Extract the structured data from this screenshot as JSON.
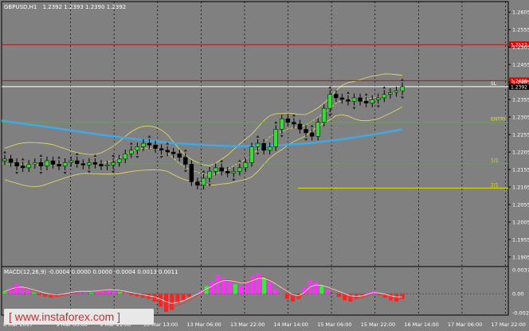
{
  "header": {
    "symbol": "GBPUSD,H1",
    "ohlc": "1.2392 1.2393 1.2390 1.2392"
  },
  "watermark": "[  www.instaforex.com ]",
  "macd_header": "MACD(12,26,9) -0.0004 0.0000 0.0000 -0.0004 0.0013 0.0011",
  "chart_data": {
    "type": "line",
    "symbol": "GBPUSD",
    "timeframe": "H1",
    "price_axis": {
      "ticks": [
        1.2605,
        1.2555,
        1.2505,
        1.2455,
        1.2405,
        1.2355,
        1.2305,
        1.2255,
        1.2205,
        1.2155,
        1.2105,
        1.2055,
        1.2005,
        1.1955,
        1.1905
      ],
      "ylim": [
        1.188,
        1.2635
      ]
    },
    "macd_axis": {
      "ticks": [
        "0.0037",
        "0.00",
        "-0.0029"
      ],
      "ylim": [
        -0.0033,
        0.0041
      ]
    },
    "x_ticks": [
      "8 Mar 2017",
      "9 Mar 05:00",
      "9 Mar 21:00",
      "10 Mar 13:00",
      "13 Mar 06:00",
      "13 Mar 22:00",
      "14 Mar 14:00",
      "15 Mar 06:00",
      "15 Mar 22:00",
      "16 Mar 14:00",
      "17 Mar 06:00",
      "17 Mar 22:00"
    ],
    "levels": [
      {
        "label": "",
        "price_label": "1.2512",
        "value": 1.2512,
        "color": "#e00000"
      },
      {
        "label": "",
        "price_label": "1.2409",
        "value": 1.2409,
        "color": "#e00000"
      },
      {
        "label": "SL",
        "price_label": "1.2392",
        "value": 1.2392,
        "color": "#ffffff"
      },
      {
        "label": "ENTRY",
        "price_label": "",
        "value": 1.229,
        "color": "#33cc00"
      },
      {
        "label": "1/1",
        "price_label": "",
        "value": 1.2172,
        "color": "#33cc00"
      },
      {
        "label": "2/1",
        "price_label": "",
        "value": 1.2102,
        "color": "#e0e000"
      }
    ],
    "price_series": [
      {
        "name": "GBPUSD",
        "values": [
          1.2185,
          1.2175,
          1.2165,
          1.216,
          1.217,
          1.2175,
          1.2165,
          1.218,
          1.217,
          1.2165,
          1.2175,
          1.218,
          1.2172,
          1.2168,
          1.2175,
          1.217,
          1.2165,
          1.2168,
          1.2175,
          1.2185,
          1.22,
          1.221,
          1.222,
          1.223,
          1.2225,
          1.2215,
          1.221,
          1.2205,
          1.22,
          1.219,
          1.217,
          1.212,
          1.211,
          1.213,
          1.215,
          1.216,
          1.215,
          1.2145,
          1.215,
          1.216,
          1.2175,
          1.222,
          1.223,
          1.221,
          1.222,
          1.227,
          1.23,
          1.229,
          1.2285,
          1.227,
          1.226,
          1.225,
          1.229,
          1.233,
          1.237,
          1.236,
          1.2355,
          1.235,
          1.236,
          1.235,
          1.2345,
          1.2355,
          1.236,
          1.237,
          1.2375,
          1.238,
          1.2392
        ]
      }
    ],
    "moving_average": {
      "values": [
        1.2295,
        1.2287,
        1.228,
        1.2272,
        1.2264,
        1.2256,
        1.2249,
        1.2242,
        1.2236,
        1.2231,
        1.2227,
        1.2224,
        1.2222,
        1.2222,
        1.2223,
        1.2226,
        1.223,
        1.2236,
        1.2243,
        1.2251,
        1.226,
        1.227
      ]
    },
    "macd_histogram": [
      0.0004,
      0.001,
      0.0015,
      0.0012,
      0.0006,
      0.0002,
      -0.0002,
      -0.0004,
      -0.0006,
      -0.0005,
      -0.0003,
      0.0001,
      0.0003,
      0.0002,
      0.0001,
      0.0002,
      0.0004,
      0.0006,
      0.0008,
      0.0006,
      0.0003,
      0.0001,
      -0.0002,
      -0.0004,
      -0.0006,
      -0.0008,
      -0.0012,
      -0.002,
      -0.0028,
      -0.0025,
      -0.0015,
      -0.001,
      -0.0005,
      0.0,
      0.0005,
      0.0012,
      0.002,
      0.003,
      0.0025,
      0.002,
      0.0015,
      0.0012,
      0.0018,
      0.0028,
      0.0032,
      0.0026,
      0.0018,
      0.0008,
      0.0,
      -0.0008,
      -0.0012,
      -0.0008,
      0.001,
      0.0022,
      0.0018,
      0.0012,
      0.0006,
      0.0,
      -0.0005,
      -0.001,
      -0.0012,
      -0.0008,
      -0.0004,
      0.0002,
      0.0004,
      -0.0002,
      -0.0006,
      -0.001,
      -0.0012,
      -0.0008
    ],
    "macd_signal": [
      0.0002,
      0.0006,
      0.0009,
      0.001,
      0.0008,
      0.0005,
      0.0002,
      -0.0001,
      -0.0003,
      -0.0004,
      -0.0003,
      -0.0001,
      0.0001,
      0.0002,
      0.0002,
      0.0002,
      0.0003,
      0.0004,
      0.0005,
      0.0005,
      0.0004,
      0.0002,
      0.0,
      -0.0002,
      -0.0004,
      -0.0006,
      -0.0008,
      -0.0012,
      -0.0017,
      -0.002,
      -0.0018,
      -0.0015,
      -0.001,
      -0.0005,
      0.0,
      0.0006,
      0.0012,
      0.0018,
      0.0022,
      0.0022,
      0.002,
      0.0017,
      0.0018,
      0.0022,
      0.0026,
      0.0026,
      0.0022,
      0.0016,
      0.0009,
      0.0002,
      -0.0004,
      -0.0006,
      0.0,
      0.001,
      0.0014,
      0.0013,
      0.001,
      0.0006,
      0.0002,
      -0.0002,
      -0.0006,
      -0.0007,
      -0.0006,
      -0.0003,
      0.0,
      -0.0001,
      -0.0003,
      -0.0006,
      -0.0008,
      -0.0008
    ],
    "grid": true
  },
  "colors": {
    "background": "#808080",
    "candle": "#000000",
    "up_bar": "#33dd33",
    "moving_average": "#3fa9e8",
    "bollinger": "#e8e060",
    "macd_negative": "#ff2020",
    "macd_positive": "#ff30ff",
    "macd_positive_green": "#33ee33"
  }
}
